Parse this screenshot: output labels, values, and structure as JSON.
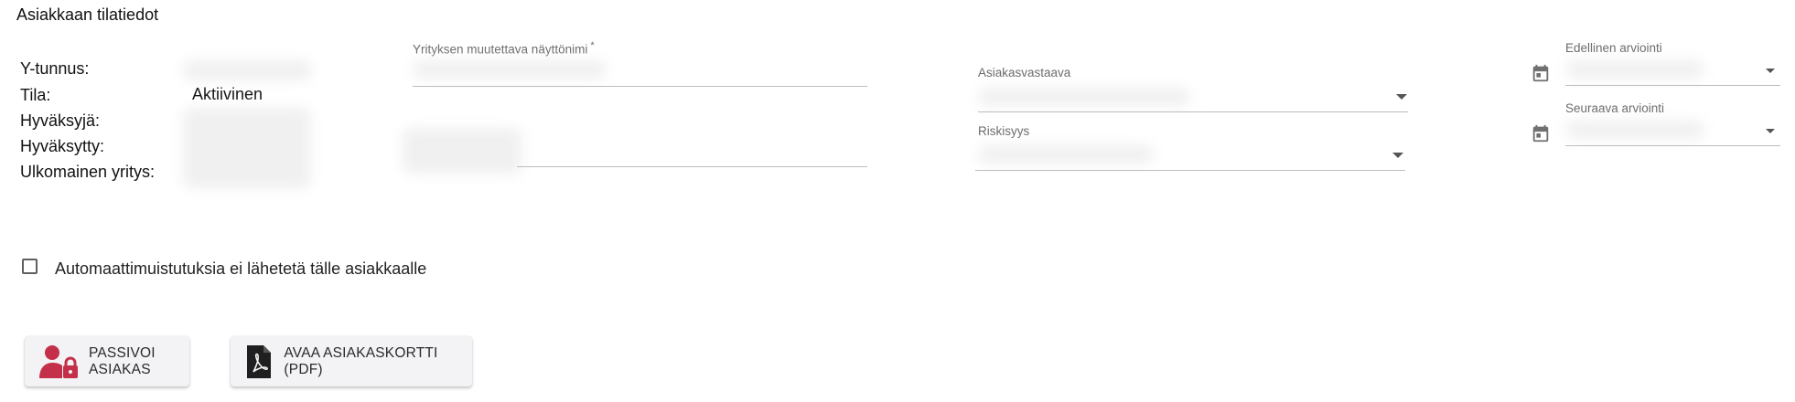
{
  "section": {
    "title": "Asiakkaan tilatiedot"
  },
  "info": {
    "labels": {
      "y_tunnus": "Y-tunnus:",
      "tila": "Tila:",
      "hyvaksyja": "Hyväksyjä:",
      "hyvaksytty": "Hyväksytty:",
      "ulkomainen": "Ulkomainen yritys:"
    },
    "tila_value": "Aktiivinen"
  },
  "fields": {
    "display_name": {
      "label": "Yrityksen muutettava näyttönimi",
      "required_mark": "*"
    },
    "account_manager": {
      "label": "Asiakasvastaava"
    },
    "riskiness": {
      "label": "Riskisyys"
    },
    "previous_review": {
      "label": "Edellinen arviointi"
    },
    "next_review": {
      "label": "Seuraava arviointi"
    }
  },
  "checkbox": {
    "label": "Automaattimuistutuksia ei lähetetä tälle asiakkaalle",
    "checked": false
  },
  "buttons": {
    "deactivate": {
      "label": "PASSIVOI ASIAKAS",
      "icon": "user-lock-icon",
      "icon_color": "#c4304a"
    },
    "open_card": {
      "label": "AVAA ASIAKASKORTTI (PDF)",
      "icon": "pdf-file-icon",
      "icon_color": "#1f1f1f"
    }
  },
  "colors": {
    "field_label": "#6b6b6b",
    "underline": "#bdbdbd",
    "button_bg": "#f3f3f5"
  }
}
